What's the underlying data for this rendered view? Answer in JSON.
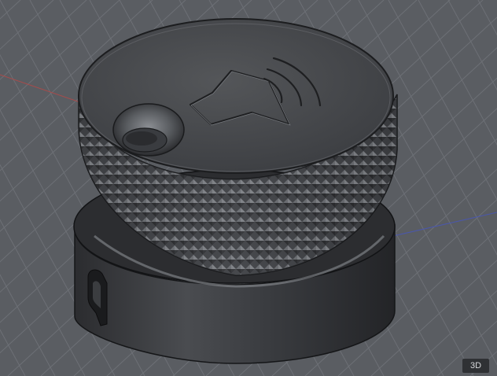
{
  "viewport": {
    "view_mode_label": "3D",
    "colors": {
      "background": "#5a5d62",
      "grid_line": "#6d7076",
      "axis_x": "#b24a4a",
      "axis_y": "#4a56b2",
      "body_dark": "#2a2b2e",
      "body_mid": "#3d3f43",
      "body_light": "#6a6d72",
      "edge": "#111214"
    },
    "model": {
      "name": "volume knob",
      "top_icon": "speaker-volume-icon"
    }
  }
}
